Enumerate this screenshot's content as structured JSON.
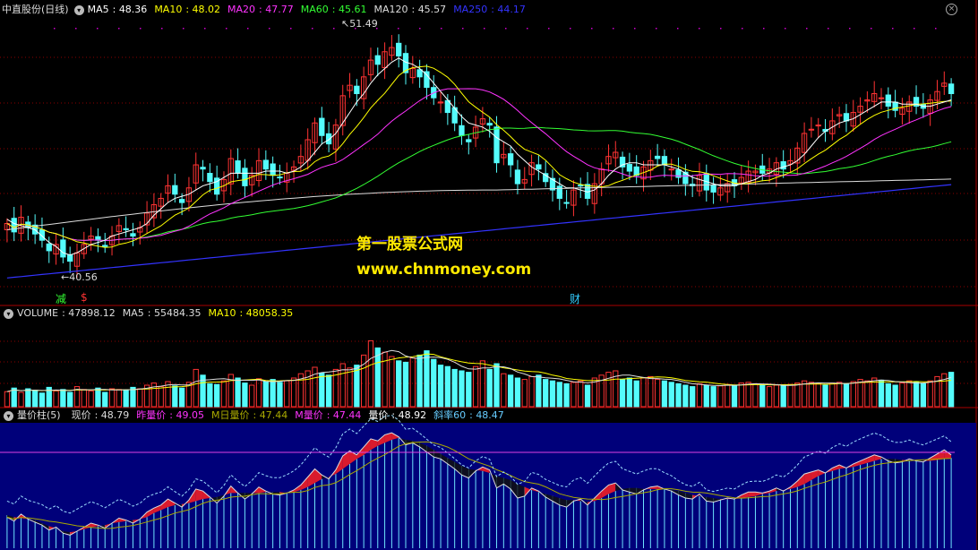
{
  "chart_data": [
    {
      "type": "candlestick",
      "title": "中直股份(日线)",
      "indicators": [
        {
          "label": "MA5",
          "value": "48.36",
          "color": "#ffffff"
        },
        {
          "label": "MA10",
          "value": "48.02",
          "color": "#ffff00"
        },
        {
          "label": "MA20",
          "value": "47.77",
          "color": "#ff33ff"
        },
        {
          "label": "MA60",
          "value": "45.61",
          "color": "#33ff33"
        },
        {
          "label": "MA120",
          "value": "45.57",
          "color": "#dddddd"
        },
        {
          "label": "MA250",
          "value": "44.17",
          "color": "#3333ff"
        }
      ],
      "ylim": [
        39.5,
        52.5
      ],
      "annotations": {
        "high": "51.49",
        "low": "40.56"
      },
      "markers": [
        {
          "text": "减",
          "color": "#33ff33"
        },
        {
          "text": "$",
          "color": "#ff3333"
        },
        {
          "text": "财",
          "color": "#33ccff"
        }
      ],
      "close": [
        42.6,
        42.2,
        42.9,
        42.4,
        42.1,
        41.8,
        41.3,
        41.6,
        41.0,
        40.8,
        41.2,
        41.6,
        42.0,
        41.8,
        41.5,
        42.0,
        42.5,
        42.3,
        42.0,
        42.4,
        43.1,
        43.5,
        43.8,
        44.4,
        44.0,
        43.6,
        44.3,
        45.4,
        45.2,
        44.6,
        44.0,
        44.7,
        45.7,
        45.0,
        44.4,
        44.9,
        45.6,
        45.2,
        44.9,
        44.8,
        45.0,
        45.3,
        45.8,
        46.6,
        47.4,
        46.8,
        46.4,
        47.3,
        48.7,
        49.2,
        48.8,
        49.6,
        50.4,
        50.2,
        50.8,
        51.0,
        50.6,
        49.8,
        50.0,
        49.6,
        49.1,
        48.6,
        48.4,
        47.9,
        47.4,
        46.8,
        46.5,
        47.2,
        47.6,
        47.3,
        45.5,
        45.9,
        45.4,
        44.5,
        44.7,
        45.5,
        45.2,
        44.6,
        44.2,
        43.8,
        43.6,
        44.2,
        44.4,
        43.8,
        44.5,
        45.2,
        45.8,
        46.0,
        45.3,
        45.1,
        44.9,
        45.3,
        45.6,
        45.7,
        45.4,
        45.2,
        44.8,
        44.5,
        44.4,
        44.9,
        44.2,
        44.1,
        44.3,
        44.5,
        44.4,
        44.8,
        45.1,
        45.1,
        45.0,
        45.2,
        45.5,
        45.2,
        45.6,
        46.2,
        46.9,
        47.1,
        47.3,
        47.0,
        47.5,
        47.8,
        47.5,
        47.9,
        48.2,
        48.5,
        48.8,
        48.6,
        48.2,
        48.0,
        48.1,
        48.4,
        48.2,
        48.1,
        48.5,
        48.9,
        49.3,
        48.8
      ],
      "ma5": [
        42.8,
        42.6,
        42.5,
        42.4,
        42.3,
        42.0,
        41.7,
        41.5,
        41.2,
        41.1,
        41.2,
        41.4,
        41.6,
        41.7,
        41.8,
        42.0,
        42.1,
        42.2,
        42.3,
        42.4,
        42.6,
        43.0,
        43.3,
        43.6,
        43.8,
        43.9,
        44.0,
        44.2,
        44.4,
        44.5,
        44.6,
        44.8,
        45.0,
        45.0,
        45.0,
        45.0,
        45.0,
        45.1,
        45.1,
        45.1,
        45.0,
        45.1,
        45.3,
        45.6,
        46.0,
        46.4,
        46.6,
        46.9,
        47.4,
        47.9,
        48.4,
        48.8,
        49.3,
        49.7,
        50.0,
        50.3,
        50.5,
        50.3,
        50.2,
        50.0,
        49.7,
        49.3,
        48.9,
        48.5,
        48.1,
        47.7,
        47.4,
        47.3,
        47.2,
        47.0,
        46.7,
        46.5,
        46.3,
        45.9,
        45.6,
        45.3,
        45.1,
        44.9,
        44.7,
        44.5,
        44.3,
        44.3,
        44.2,
        44.1,
        44.2,
        44.5,
        44.9,
        45.2,
        45.4,
        45.5,
        45.5,
        45.4,
        45.4,
        45.4,
        45.4,
        45.3,
        45.2,
        45.0,
        44.8,
        44.7,
        44.6,
        44.5,
        44.4,
        44.4,
        44.4,
        44.5,
        44.6,
        44.7,
        44.9,
        45.0,
        45.2,
        45.3,
        45.4,
        45.6,
        45.9,
        46.3,
        46.7,
        47.0,
        47.2,
        47.4,
        47.5,
        47.6,
        47.8,
        48.0,
        48.2,
        48.4,
        48.4,
        48.4,
        48.3,
        48.3,
        48.3,
        48.2,
        48.2,
        48.3,
        48.4,
        48.5
      ]
    },
    {
      "type": "bar",
      "title": "VOLUME",
      "indicators": [
        {
          "label": "VOLUME",
          "value": "47898.12",
          "color": "#dddddd"
        },
        {
          "label": "MA5",
          "value": "55484.35",
          "color": "#dddddd"
        },
        {
          "label": "MA10",
          "value": "48058.35",
          "color": "#ffff00"
        }
      ],
      "ylim": [
        0,
        120000
      ],
      "values": [
        21000,
        26000,
        20000,
        25000,
        23000,
        19000,
        27000,
        22000,
        24000,
        20000,
        28000,
        24000,
        22000,
        26000,
        20000,
        25000,
        24000,
        23000,
        27000,
        25000,
        30000,
        33000,
        28000,
        35000,
        29000,
        26000,
        34000,
        52000,
        44000,
        32000,
        31000,
        36000,
        45000,
        40000,
        33000,
        30000,
        39000,
        35000,
        38000,
        34000,
        36000,
        40000,
        46000,
        50000,
        55000,
        47000,
        44000,
        52000,
        60000,
        54000,
        58000,
        72000,
        92000,
        82000,
        76000,
        70000,
        64000,
        62000,
        68000,
        72000,
        78000,
        66000,
        58000,
        56000,
        52000,
        50000,
        48000,
        56000,
        64000,
        52000,
        60000,
        46000,
        44000,
        40000,
        38000,
        42000,
        44000,
        38000,
        36000,
        34000,
        32000,
        34000,
        36000,
        30000,
        40000,
        44000,
        48000,
        50000,
        38000,
        40000,
        36000,
        40000,
        42000,
        38000,
        36000,
        34000,
        32000,
        30000,
        28000,
        32000,
        30000,
        28000,
        29000,
        31000,
        30000,
        33000,
        34000,
        32000,
        30000,
        28000,
        30000,
        29000,
        31000,
        33000,
        36000,
        34000,
        32000,
        30000,
        33000,
        34000,
        32000,
        35000,
        38000,
        36000,
        40000,
        37000,
        32000,
        30000,
        33000,
        36000,
        34000,
        32000,
        36000,
        42000,
        46000,
        48000
      ]
    },
    {
      "type": "line",
      "title": "量价柱(5)",
      "indicators": [
        {
          "label": "现价",
          "value": "48.79",
          "color": "#dddddd"
        },
        {
          "label": "昨量价",
          "value": "49.05",
          "color": "#ff33ff"
        },
        {
          "label": "M日量价",
          "value": "47.44",
          "color": "#aaaa00"
        },
        {
          "label": "M量价",
          "value": "47.44",
          "color": "#ff33ff"
        },
        {
          "label": "量价",
          "value": "48.92",
          "color": "#ffffff"
        },
        {
          "label": "斜率60",
          "value": "48.47",
          "color": "#66ccff"
        }
      ],
      "reference_line": 49.05
    }
  ],
  "watermark": {
    "line1": "第一股票公式网",
    "line2": "www.chnmoney.com"
  },
  "icons": {
    "panel_toggle": "chevron-down-icon",
    "close": "close-icon"
  },
  "colors": {
    "up": "#ff3333",
    "down": "#54fcfc",
    "grid": "#8b0000",
    "vpanel_bg": "#00007a"
  }
}
